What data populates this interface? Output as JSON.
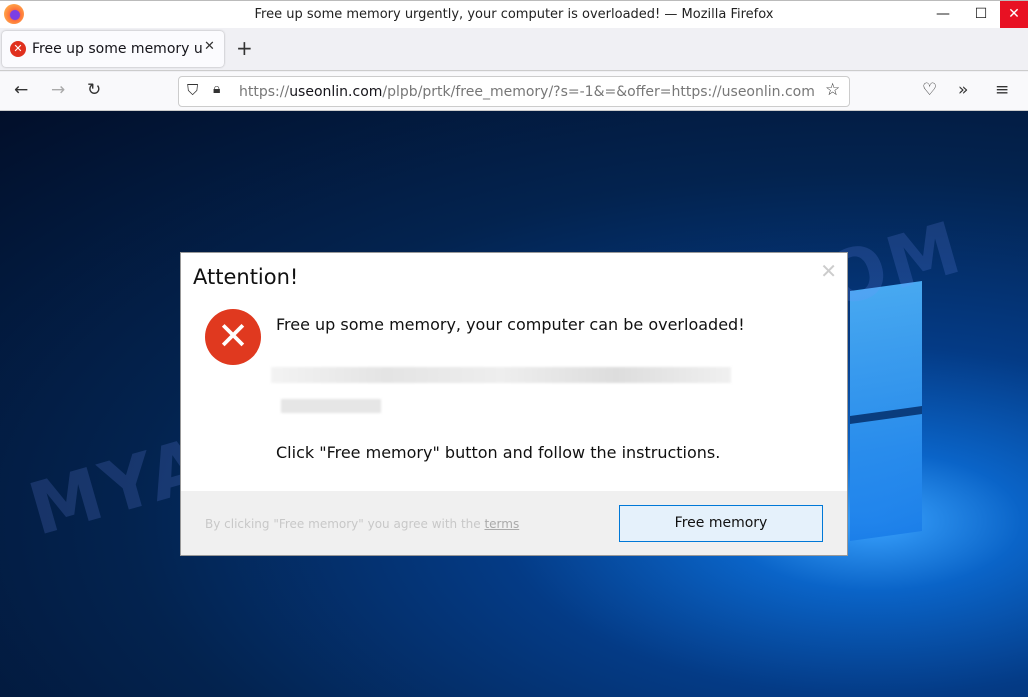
{
  "window": {
    "title": "Free up some memory urgently, your computer is overloaded! — Mozilla Firefox",
    "minimize": "—",
    "maximize": "☐",
    "close": "✕"
  },
  "tab": {
    "label": "Free up some memory urgently, your computer is overloaded!",
    "close": "✕",
    "new_tab": "+"
  },
  "nav": {
    "back": "←",
    "forward": "→",
    "reload": "↻",
    "url_prefix": "https://",
    "url_domain": "useonlin.com",
    "url_path": "/plpb/prtk/free_memory/?s=-1&=&offer=https://useonlin.com",
    "bookmark": "☆",
    "pocket": "♡",
    "overflow": "»",
    "menu": "≡"
  },
  "watermark": "MYANTISPYWARE.COM",
  "dialog": {
    "title": "Attention!",
    "close": "✕",
    "message": "Free up some memory, your computer can be overloaded!",
    "instruction": "Click \"Free memory\" button and follow the instructions.",
    "agree_text": "By clicking \"Free memory\" you agree with the ",
    "terms": "terms",
    "button": "Free memory"
  }
}
